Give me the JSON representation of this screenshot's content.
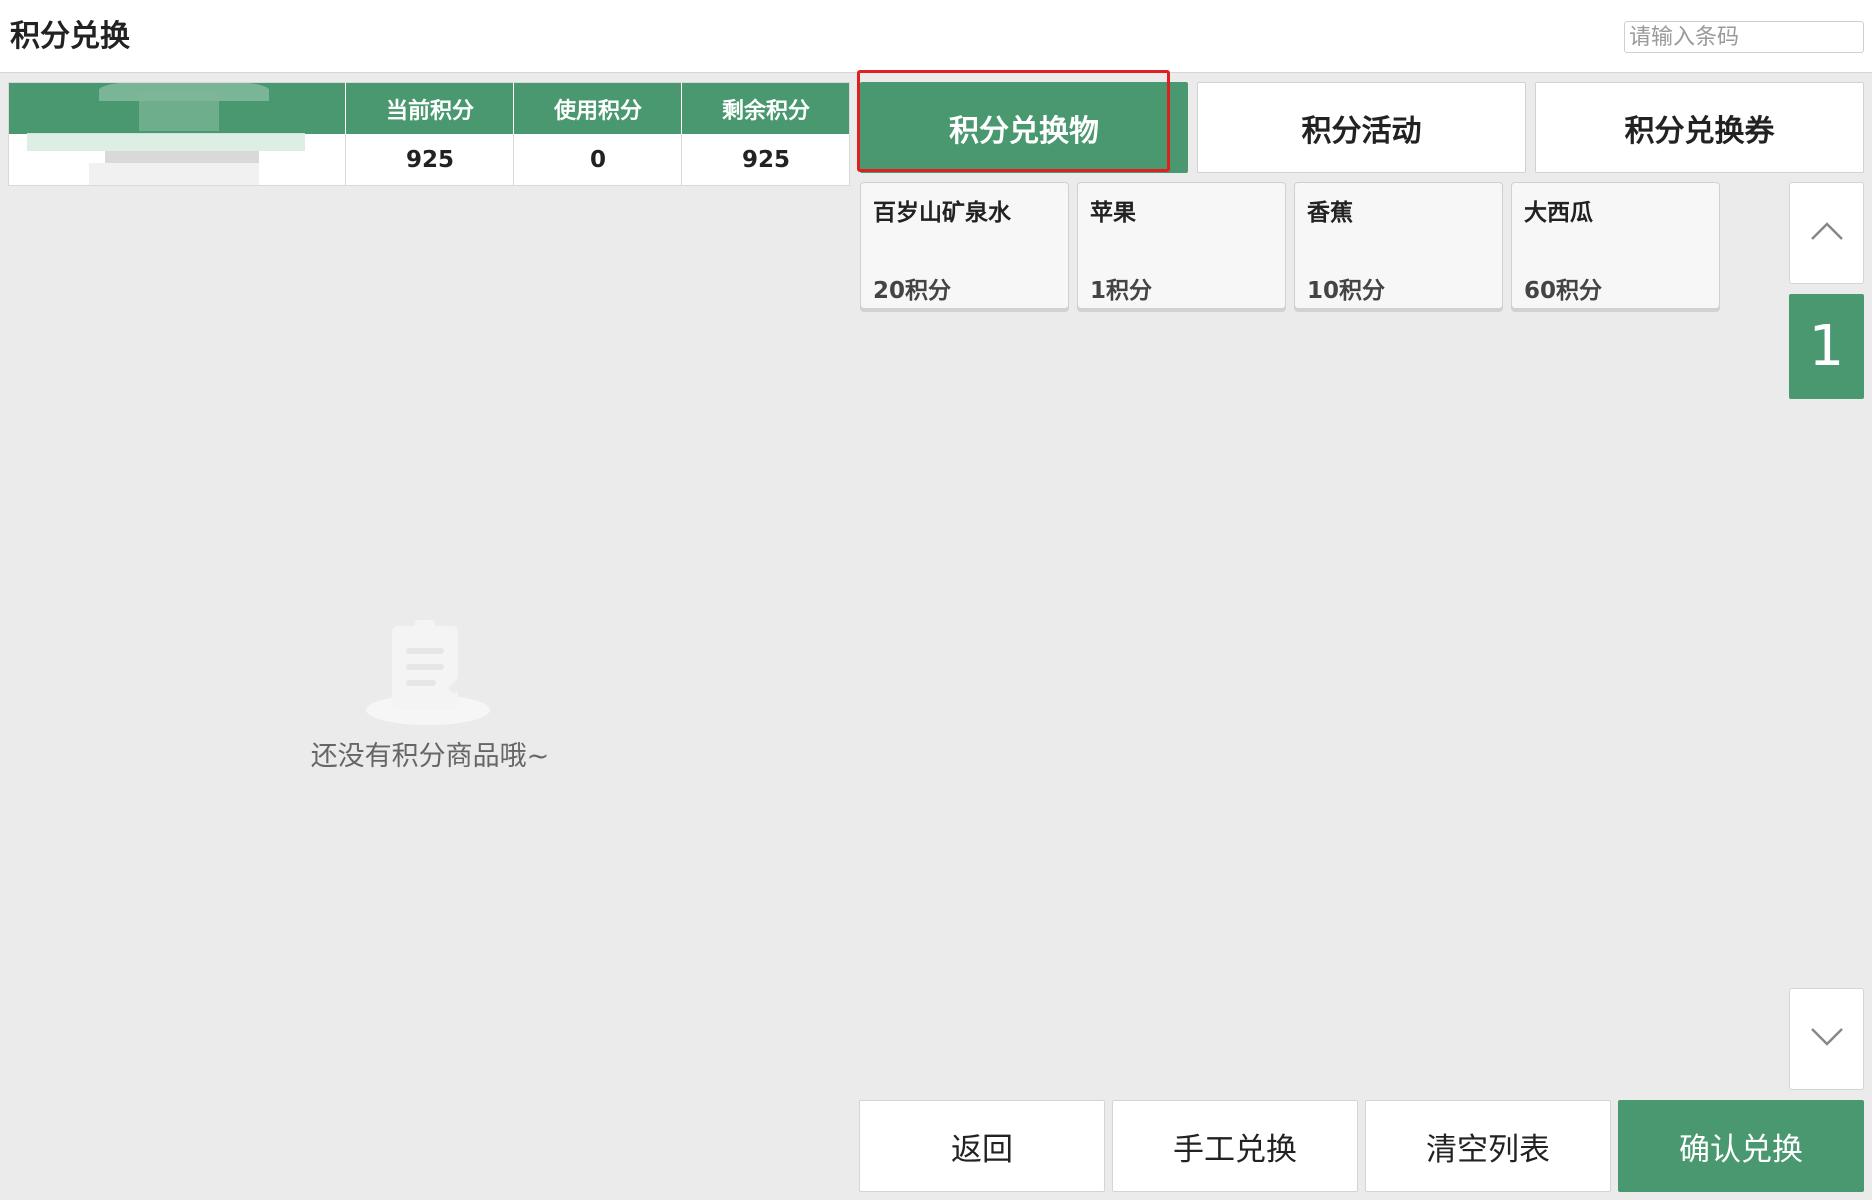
{
  "header": {
    "title": "积分兑换",
    "barcode_placeholder": "请输入条码"
  },
  "points_table": {
    "columns": [
      "当前积分",
      "使用积分",
      "剩余积分"
    ],
    "values": [
      "925",
      "0",
      "925"
    ]
  },
  "empty_state": {
    "text": "还没有积分商品哦~",
    "icon": "clipboard-icon"
  },
  "tabs": [
    {
      "label": "积分兑换物",
      "active": true
    },
    {
      "label": "积分活动",
      "active": false
    },
    {
      "label": "积分兑换券",
      "active": false
    }
  ],
  "products": [
    {
      "name": "百岁山矿泉水",
      "points": "20积分"
    },
    {
      "name": "苹果",
      "points": "1积分"
    },
    {
      "name": "香蕉",
      "points": "10积分"
    },
    {
      "name": "大西瓜",
      "points": "60积分"
    }
  ],
  "pager": {
    "page": "1",
    "up_icon": "chevron-up-icon",
    "down_icon": "chevron-down-icon"
  },
  "actions": {
    "back": "返回",
    "manual": "手工兑换",
    "clear": "清空列表",
    "confirm": "确认兑换"
  },
  "colors": {
    "accent": "#4a9870",
    "highlight": "#e02020",
    "background": "#ebebeb"
  }
}
